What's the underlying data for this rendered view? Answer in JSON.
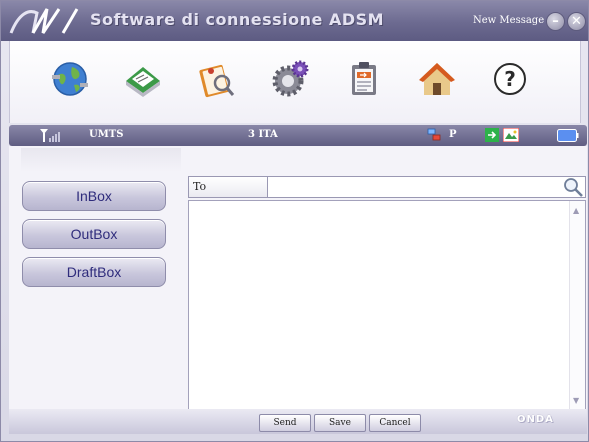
{
  "window": {
    "title": "Software di connessione ADSM",
    "new_message_label": "New Message",
    "minimize_glyph": "–",
    "close_glyph": "✕"
  },
  "toolbar": {
    "items": [
      {
        "icon": "globe-connect-icon"
      },
      {
        "icon": "sms-envelope-icon"
      },
      {
        "icon": "phonebook-icon"
      },
      {
        "icon": "settings-gear-icon"
      },
      {
        "icon": "clipboard-log-icon"
      },
      {
        "icon": "home-icon"
      },
      {
        "icon": "help-icon",
        "glyph": "?"
      }
    ]
  },
  "status": {
    "network_type": "UMTS",
    "operator": "3 ITA",
    "mode": "P"
  },
  "sidebar": {
    "items": [
      {
        "label": "InBox"
      },
      {
        "label": "OutBox"
      },
      {
        "label": "DraftBox"
      }
    ]
  },
  "compose": {
    "to_label": "To",
    "to_value": "",
    "body": ""
  },
  "actions": {
    "send": "Send",
    "save": "Save",
    "cancel": "Cancel"
  },
  "brand": {
    "name": "ONDA"
  },
  "colors": {
    "title_bar": "#6c6a90",
    "accent_text": "#2f2c7c"
  }
}
